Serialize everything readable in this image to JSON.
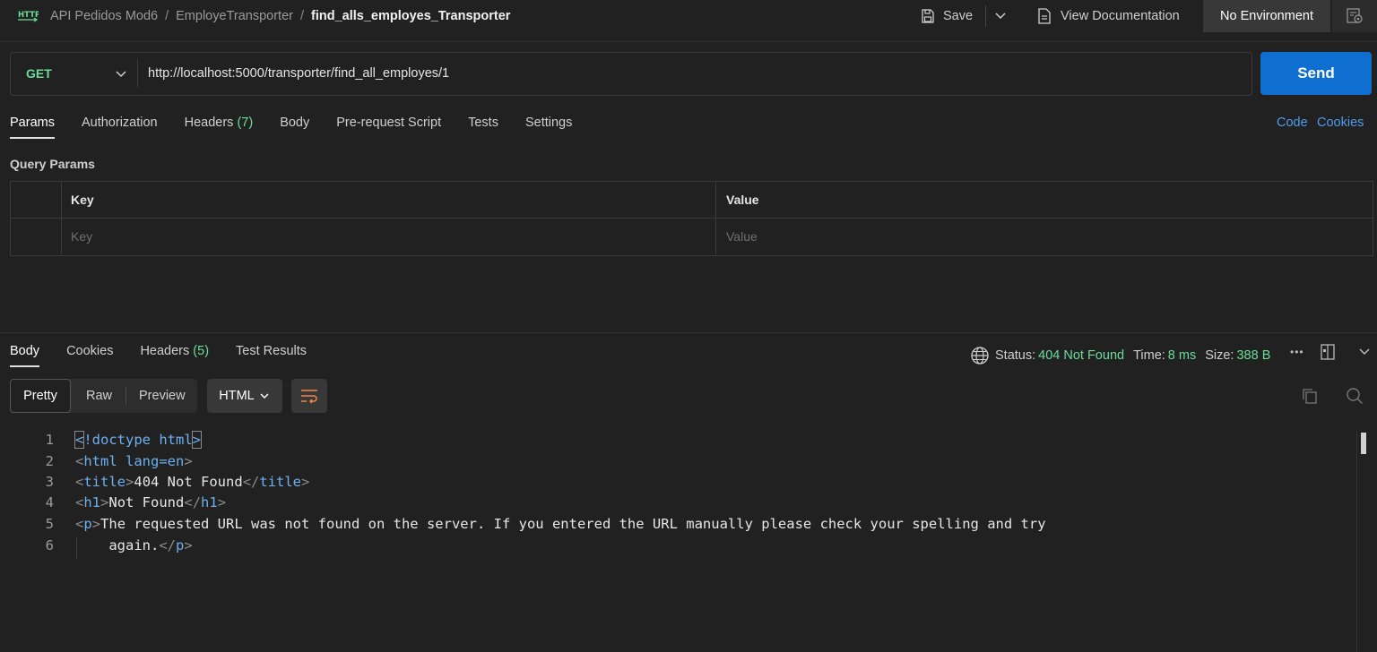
{
  "breadcrumb": {
    "protocol_icon": "http-icon",
    "collection": "API Pedidos Mod6",
    "folder": "EmployeTransporter",
    "request": "find_alls_employes_Transporter"
  },
  "toolbar": {
    "save_label": "Save",
    "view_doc_label": "View Documentation",
    "environment": "No Environment"
  },
  "request": {
    "method": "GET",
    "url": "http://localhost:5000/transporter/find_all_employes/1",
    "send_label": "Send"
  },
  "request_tabs": [
    {
      "label": "Params",
      "count": ""
    },
    {
      "label": "Authorization",
      "count": ""
    },
    {
      "label": "Headers",
      "count": "(7)"
    },
    {
      "label": "Body",
      "count": ""
    },
    {
      "label": "Pre-request Script",
      "count": ""
    },
    {
      "label": "Tests",
      "count": ""
    },
    {
      "label": "Settings",
      "count": ""
    }
  ],
  "links": {
    "code": "Code",
    "cookies": "Cookies"
  },
  "query_params": {
    "title": "Query Params",
    "key_header": "Key",
    "value_header": "Value",
    "key_placeholder": "Key",
    "value_placeholder": "Value"
  },
  "response_tabs": [
    {
      "label": "Body",
      "count": ""
    },
    {
      "label": "Cookies",
      "count": ""
    },
    {
      "label": "Headers",
      "count": "(5)"
    },
    {
      "label": "Test Results",
      "count": ""
    }
  ],
  "status": {
    "status_label": "Status:",
    "status_value": "404 Not Found",
    "time_label": "Time:",
    "time_value": "8 ms",
    "size_label": "Size:",
    "size_value": "388 B"
  },
  "view": {
    "pretty": "Pretty",
    "raw": "Raw",
    "preview": "Preview",
    "format": "HTML"
  },
  "code_lines": [
    {
      "n": "1"
    },
    {
      "n": "2"
    },
    {
      "n": "3"
    },
    {
      "n": "4"
    },
    {
      "n": "5"
    },
    {
      "n": "6"
    }
  ],
  "code_text": {
    "doctype": "!doctype html",
    "html_open": "html lang=en",
    "title_tag": "title",
    "title_text": "404 Not Found",
    "h1_tag": "h1",
    "h1_text": "Not Found",
    "p_tag": "p",
    "p_text": "The requested URL was not found on the server. If you entered the URL manually please check your spelling and try",
    "p_text2": "again."
  },
  "colors": {
    "accent_blue": "#0f6fd1",
    "success_green": "#6bdd9a",
    "link_blue": "#4d9cf0"
  }
}
